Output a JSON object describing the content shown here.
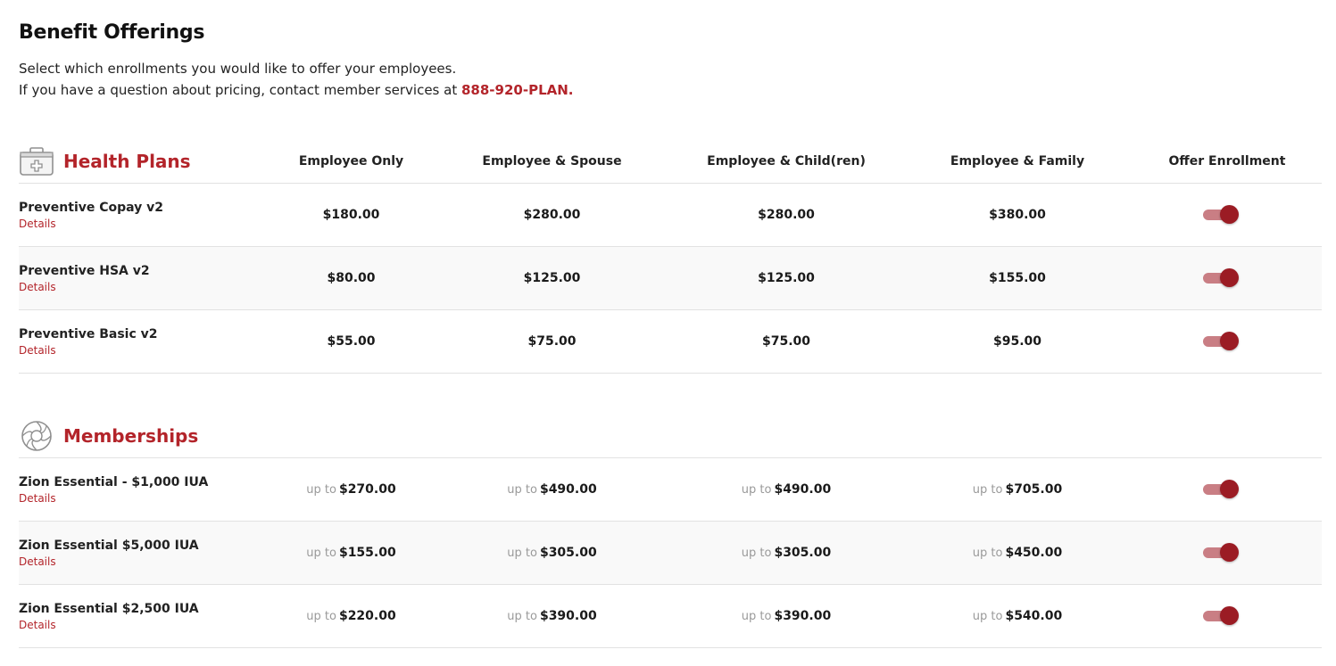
{
  "header": {
    "title": "Benefit Offerings",
    "intro_line1": "Select which enrollments you would like to offer your employees.",
    "intro_line2": "If you have a question about pricing, contact member services at",
    "phone": "888-920-PLAN."
  },
  "columns": {
    "employee_only": "Employee Only",
    "employee_spouse": "Employee & Spouse",
    "employee_children": "Employee & Child(ren)",
    "employee_family": "Employee & Family",
    "offer_enrollment": "Offer Enrollment"
  },
  "details_label": "Details",
  "upto_label": "up to",
  "colors": {
    "accent": "#b3242a",
    "toggle_knob": "#9b1c24",
    "toggle_track": "#c97e84"
  },
  "health": {
    "title": "Health Plans",
    "icon": "medical-kit-icon",
    "plans": [
      {
        "name": "Preventive Copay v2",
        "prices": [
          "$180.00",
          "$280.00",
          "$280.00",
          "$380.00"
        ],
        "offered": true
      },
      {
        "name": "Preventive HSA v2",
        "prices": [
          "$80.00",
          "$125.00",
          "$125.00",
          "$155.00"
        ],
        "offered": true
      },
      {
        "name": "Preventive Basic v2",
        "prices": [
          "$55.00",
          "$75.00",
          "$75.00",
          "$95.00"
        ],
        "offered": true
      }
    ]
  },
  "memberships": {
    "title": "Memberships",
    "icon": "aperture-logo-icon",
    "plans": [
      {
        "name": "Zion Essential - $1,000 IUA",
        "prices": [
          "$270.00",
          "$490.00",
          "$490.00",
          "$705.00"
        ],
        "offered": true
      },
      {
        "name": "Zion Essential $5,000 IUA",
        "prices": [
          "$155.00",
          "$305.00",
          "$305.00",
          "$450.00"
        ],
        "offered": true
      },
      {
        "name": "Zion Essential $2,500 IUA",
        "prices": [
          "$220.00",
          "$390.00",
          "$390.00",
          "$540.00"
        ],
        "offered": true
      }
    ]
  }
}
